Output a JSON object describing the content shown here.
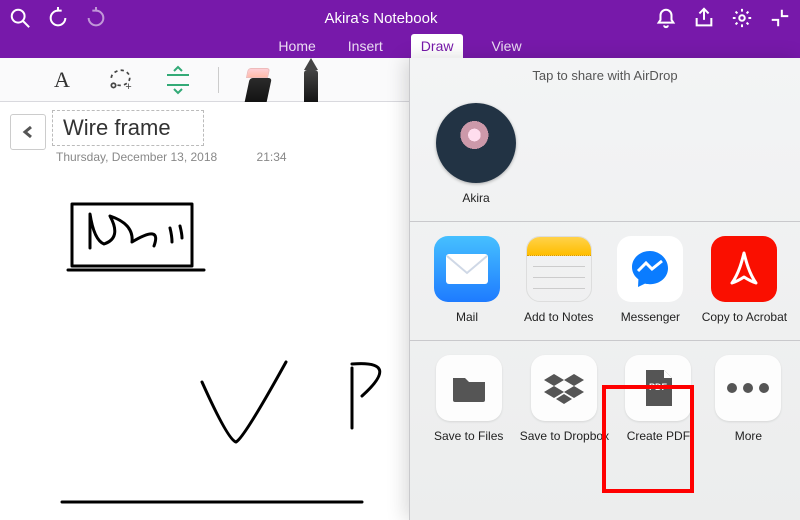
{
  "titlebar": {
    "title": "Akira's Notebook"
  },
  "tabs": {
    "home": "Home",
    "insert": "Insert",
    "draw": "Draw",
    "view": "View"
  },
  "page": {
    "title": "Wire frame",
    "date": "Thursday, December 13, 2018",
    "time": "21:34"
  },
  "share": {
    "caption": "Tap to share with AirDrop",
    "airdrop_name": "Akira",
    "apps": [
      {
        "label": "Mail"
      },
      {
        "label": "Add to Notes"
      },
      {
        "label": "Messenger"
      },
      {
        "label": "Copy to Acrobat"
      }
    ],
    "actions": [
      {
        "label": "Save to Files"
      },
      {
        "label": "Save to Dropbox"
      },
      {
        "label": "Create PDF"
      },
      {
        "label": "More"
      }
    ]
  }
}
